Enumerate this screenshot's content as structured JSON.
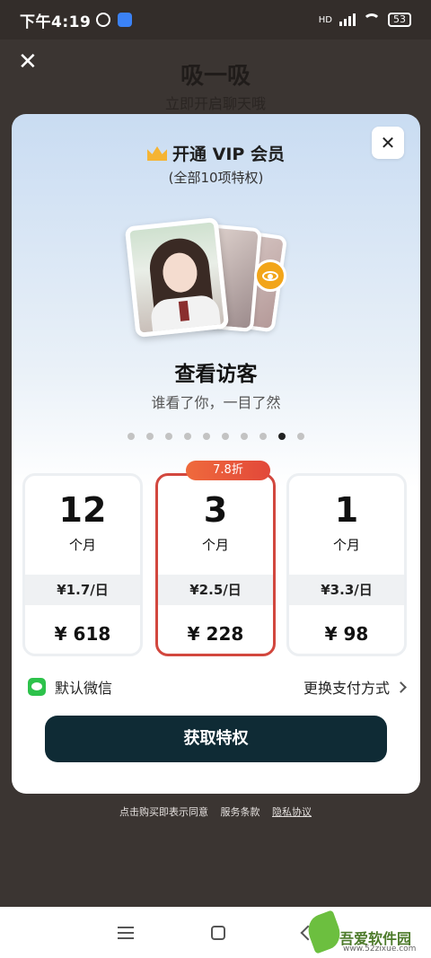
{
  "status_bar": {
    "time": "下午4:19",
    "network": "HD",
    "battery": "53"
  },
  "background_page": {
    "title": "吸一吸",
    "subtitle": "立即开启聊天哦"
  },
  "modal": {
    "title": "开通 VIP 会员",
    "subtitle": "(全部10项特权)",
    "feature": {
      "title": "查看访客",
      "description": "谁看了你，一目了然"
    },
    "carousel": {
      "total_dots": 10,
      "active_index": 8
    },
    "plans": [
      {
        "duration": "12",
        "unit": "个月",
        "daily": "¥1.7/日",
        "price": "¥ 618",
        "selected": false
      },
      {
        "duration": "3",
        "unit": "个月",
        "daily": "¥2.5/日",
        "price": "¥ 228",
        "selected": true,
        "discount": "7.8折"
      },
      {
        "duration": "1",
        "unit": "个月",
        "daily": "¥3.3/日",
        "price": "¥ 98",
        "selected": false
      }
    ],
    "payment": {
      "default_method": "默认微信",
      "change_label": "更换支付方式"
    },
    "cta_label": "获取特权"
  },
  "terms": {
    "prefix": "点击购买即表示同意",
    "service": "服务条款",
    "privacy": "隐私协议"
  },
  "watermark": {
    "name": "吾爱软件园",
    "url": "www.52zixue.com"
  },
  "colors": {
    "accent": "#d2473e",
    "cta_bg": "#0f2b35",
    "wechat": "#2dc24b",
    "eye_badge": "#f2a51a"
  }
}
